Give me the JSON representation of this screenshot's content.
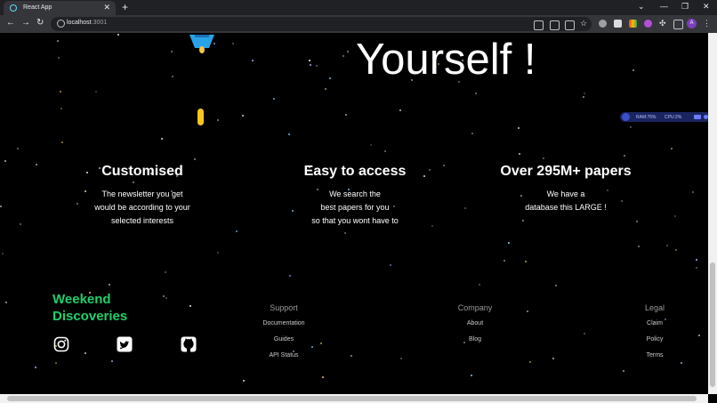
{
  "browser": {
    "tab_title": "React App",
    "url_host": "localhost",
    "url_port": ":3001",
    "profile_initial": "A"
  },
  "hero": {
    "title": "Yourself !"
  },
  "features": [
    {
      "title": "Customised",
      "lines": [
        "The newsletter you get",
        "would be according to your",
        "selected interests"
      ]
    },
    {
      "title": "Easy to access",
      "lines": [
        "We search the",
        "best papers for you",
        "so that you wont have to"
      ]
    },
    {
      "title": "Over 295M+ papers",
      "lines": [
        "We have a",
        "database this LARGE !"
      ]
    }
  ],
  "footer": {
    "brand_line1": "Weekend",
    "brand_line2": "Discoveries",
    "socials": [
      "instagram-icon",
      "twitter-icon",
      "github-icon"
    ],
    "columns": [
      {
        "heading": "Support",
        "links": [
          "Documentation",
          "Guides",
          "API Status"
        ]
      },
      {
        "heading": "Company",
        "links": [
          "About",
          "Blog"
        ]
      },
      {
        "heading": "Legal",
        "links": [
          "Claim",
          "Policy",
          "Terms"
        ]
      }
    ]
  },
  "widget": {
    "ram": "RAM:76%",
    "cpu": "CPU:2%"
  },
  "colors": {
    "brand_green": "#1fcf6c",
    "background": "#000000",
    "rocket_blue": "#29a3e8",
    "capsule_yellow": "#f7c51e"
  }
}
